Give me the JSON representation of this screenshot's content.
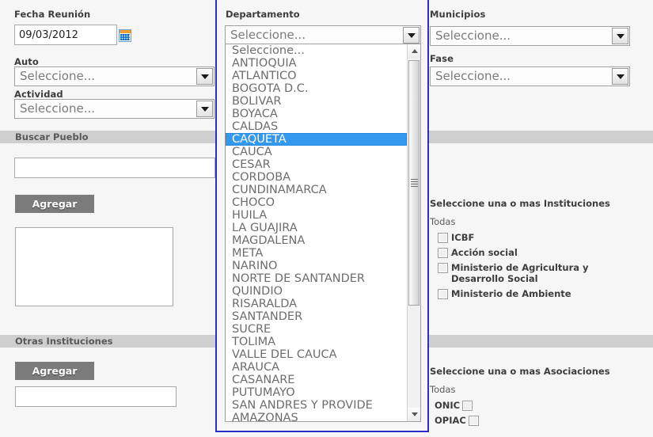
{
  "left_column": {
    "fecha_label": "Fecha Reunión",
    "fecha_value": "09/03/2012",
    "calendar_icon": "calendar-icon",
    "auto_label": "Auto",
    "auto_value": "Seleccione...",
    "actividad_label": "Actividad",
    "actividad_value": "Seleccione...",
    "buscar_pueblo_bar": "Buscar Pueblo",
    "buscar_pueblo_value": "",
    "agregar_pueblo_label": "Agregar",
    "pueblo_list_value": "",
    "otras_instituciones_bar": "Otras Instituciones",
    "agregar_otras_label": "Agregar",
    "otras_value": ""
  },
  "dropdown_panel": {
    "title": "Departamento",
    "selected_display": "Seleccione...",
    "open": true,
    "highlighted": "CAQUETA",
    "options": [
      "Seleccione...",
      "ANTIOQUIA",
      "ATLANTICO",
      "BOGOTA D.C.",
      "BOLIVAR",
      "BOYACA",
      "CALDAS",
      "CAQUETA",
      "CAUCA",
      "CESAR",
      "CORDOBA",
      "CUNDINAMARCA",
      "CHOCO",
      "HUILA",
      "LA GUAJIRA",
      "MAGDALENA",
      "META",
      "NARINO",
      "NORTE DE SANTANDER",
      "QUINDIO",
      "RISARALDA",
      "SANTANDER",
      "SUCRE",
      "TOLIMA",
      "VALLE DEL CAUCA",
      "ARAUCA",
      "CASANARE",
      "PUTUMAYO",
      "SAN ANDRES Y PROVIDE",
      "AMAZONAS"
    ]
  },
  "right_column": {
    "municipios_label": "Municipios",
    "municipios_value": "Seleccione...",
    "fase_label": "Fase",
    "fase_value": "Seleccione...",
    "instituciones_heading": "Seleccione una o mas Instituciones",
    "instituciones_todas": "Todas",
    "instituciones": [
      {
        "label": "ICBF",
        "checked": false
      },
      {
        "label": "Acción social",
        "checked": false
      },
      {
        "label": "Ministerio de Agricultura y Desarrollo Social",
        "checked": false
      },
      {
        "label": "Ministerio de Ambiente",
        "checked": false
      }
    ],
    "asociaciones_heading": "Seleccione una o mas Asociaciones",
    "asociaciones_todas": "Todas",
    "asociaciones": [
      {
        "label": "ONIC",
        "checked": false
      },
      {
        "label": "OPIAC",
        "checked": false
      }
    ]
  },
  "colors": {
    "page_bg": "#f6f6f6",
    "section_bar": "#cfcfcf",
    "button_bg": "#7b7b7b",
    "panel_border": "#2b2ec9",
    "highlight": "#3399ee",
    "label_text": "#3d3d3d"
  }
}
